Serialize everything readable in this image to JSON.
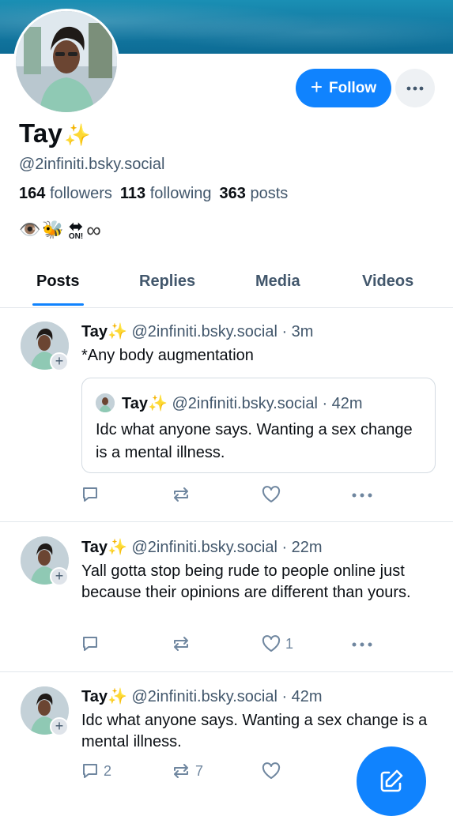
{
  "profile": {
    "display_name": "Tay",
    "name_emoji": "✨",
    "handle": "@2infiniti.bsky.social",
    "followers_count": "164",
    "followers_label": "followers",
    "following_count": "113",
    "following_label": "following",
    "posts_count": "363",
    "posts_label": "posts",
    "bio": {
      "eye": "👁️",
      "bee": "🐝",
      "arrows": "⬌",
      "on": "ON!",
      "infinity": "∞"
    }
  },
  "actions": {
    "follow_label": "Follow",
    "follow_icon": "+",
    "more_icon": "more-icon"
  },
  "tabs": [
    {
      "label": "Posts"
    },
    {
      "label": "Replies"
    },
    {
      "label": "Media"
    },
    {
      "label": "Videos"
    }
  ],
  "posts": [
    {
      "author": "Tay",
      "emoji": "✨",
      "handle": "@2infiniti.bsky.social",
      "time": "· 3m",
      "text": "*Any body augmentation",
      "quote": {
        "author": "Tay",
        "emoji": "✨",
        "handle": "@2infiniti.bsky.social",
        "time": "· 42m",
        "text": "Idc what anyone says. Wanting a sex change is a mental illness."
      },
      "replies": "",
      "reposts": "",
      "likes": ""
    },
    {
      "author": "Tay",
      "emoji": "✨",
      "handle": "@2infiniti.bsky.social",
      "time": "· 22m",
      "text": "Yall gotta stop being rude to people online just because their opinions are different than yours.",
      "replies": "",
      "reposts": "",
      "likes": "1"
    },
    {
      "author": "Tay",
      "emoji": "✨",
      "handle": "@2infiniti.bsky.social",
      "time": "· 42m",
      "text": "Idc what anyone says. Wanting a sex change is a mental illness.",
      "replies": "2",
      "reposts": "7",
      "likes": ""
    }
  ],
  "colors": {
    "accent": "#1083fe",
    "muted_text": "#42576c",
    "icon": "#6f869f",
    "divider": "#e2e7ec"
  }
}
